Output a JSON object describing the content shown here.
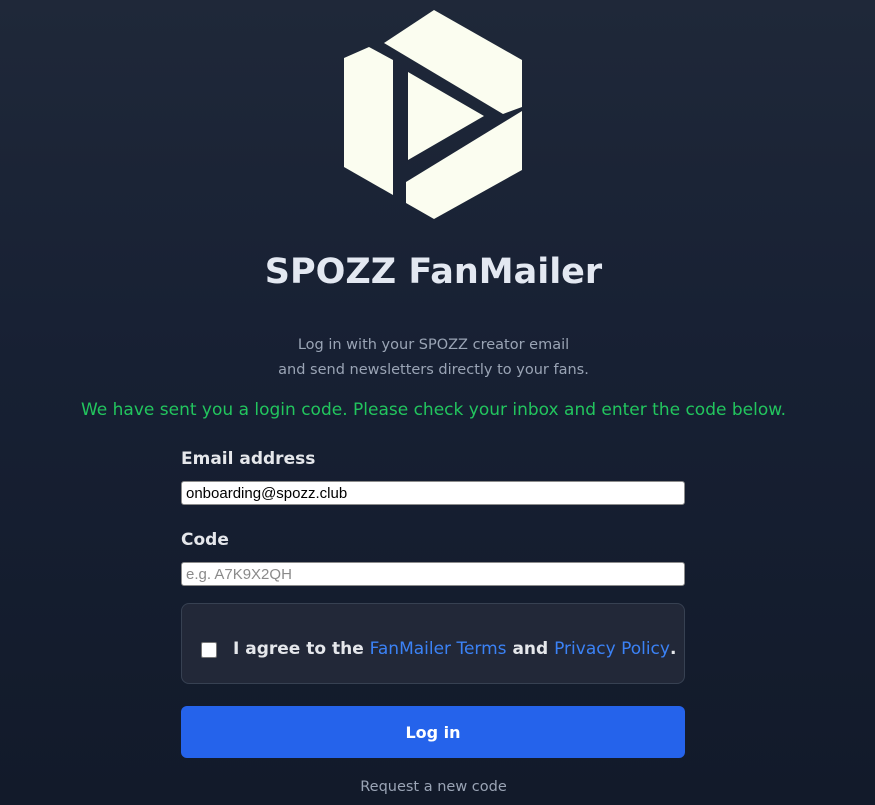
{
  "app": {
    "title": "SPOZZ FanMailer",
    "subtitle_line1": "Log in with your SPOZZ creator email",
    "subtitle_line2": "and send newsletters directly to your fans.",
    "logo_icon": "spozz-play-hexagon-icon",
    "logo_color": "#fbfdf0"
  },
  "status": {
    "message": "We have sent you a login code. Please check your inbox and enter the code below.",
    "color": "#22c55e"
  },
  "form": {
    "email_label": "Email address",
    "email_value": "onboarding@spozz.club",
    "code_label": "Code",
    "code_value": "",
    "code_placeholder": "e.g. A7K9X2QH",
    "consent_prefix": "I agree to the",
    "consent_terms_link": "FanMailer Terms",
    "consent_and": "and",
    "consent_privacy_link": "Privacy Policy",
    "consent_suffix": ".",
    "consent_checked": false,
    "login_label": "Log in",
    "resend_label": "Request a new code"
  },
  "colors": {
    "accent": "#2563eb",
    "link": "#3b82f6",
    "background": "#1b2334"
  }
}
